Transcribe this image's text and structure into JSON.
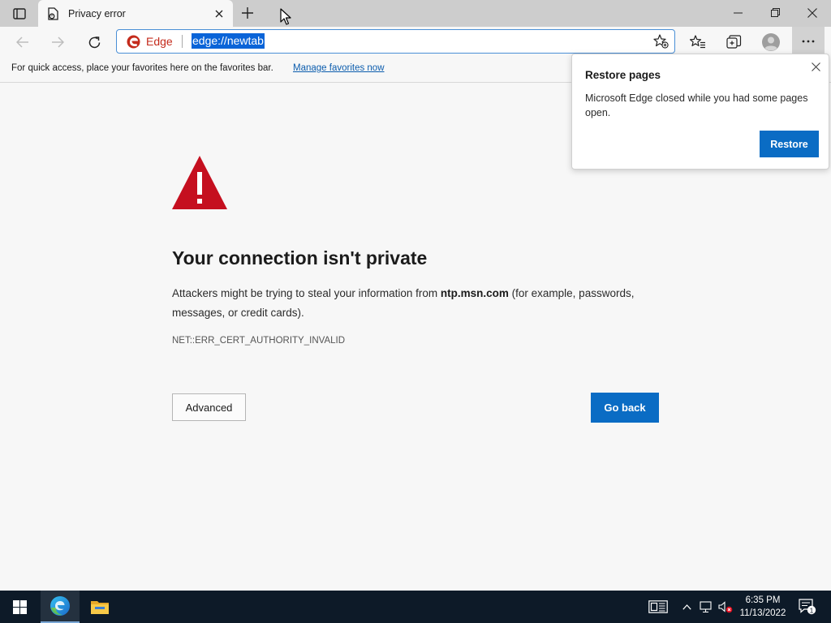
{
  "tab": {
    "title": "Privacy error"
  },
  "omnibox": {
    "site_label": "Edge",
    "url": "edge://newtab"
  },
  "favorites_bar": {
    "message": "For quick access, place your favorites here on the favorites bar.",
    "link": "Manage favorites now"
  },
  "page": {
    "heading": "Your connection isn't private",
    "desc_before": "Attackers might be trying to steal your information from ",
    "desc_host": "ntp.msn.com",
    "desc_after": " (for example, passwords, messages, or credit cards).",
    "error_code": "NET::ERR_CERT_AUTHORITY_INVALID",
    "advanced_label": "Advanced",
    "go_back_label": "Go back"
  },
  "restore_popup": {
    "title": "Restore pages",
    "body": "Microsoft Edge closed while you had some pages open.",
    "button": "Restore"
  },
  "taskbar": {
    "time": "6:35 PM",
    "date": "11/13/2022",
    "notification_count": "1"
  },
  "colors": {
    "accent": "#0a6cc4",
    "warning": "#c50f1f",
    "taskbar": "#0d1a28"
  }
}
